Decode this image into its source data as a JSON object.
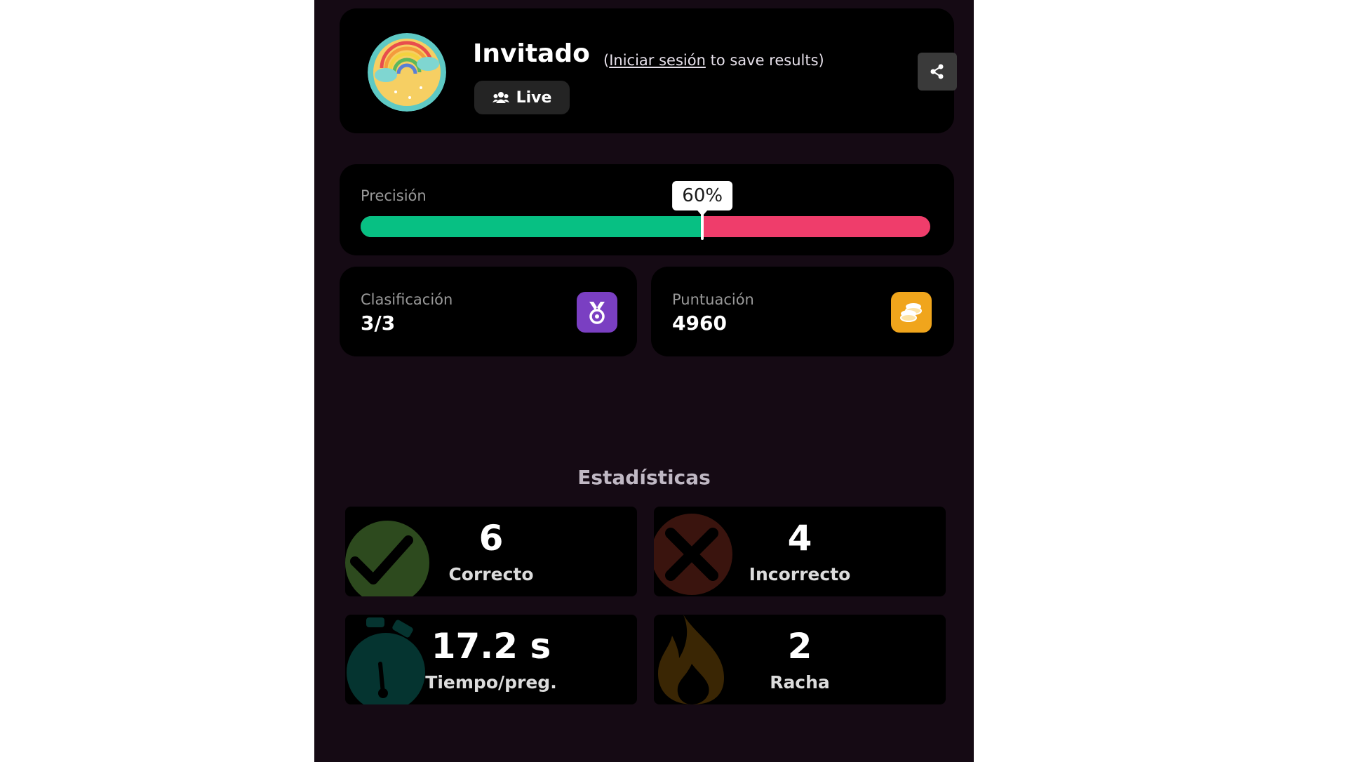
{
  "header": {
    "username": "Invitado",
    "login_prefix": "(",
    "login_link": "Iniciar sesión",
    "login_suffix": " to save results)",
    "mode_label": "Live"
  },
  "precision": {
    "label": "Precisión",
    "percent_text": "60%",
    "value": 0.6,
    "correct_color": "#07c083",
    "incorrect_color": "#ef3d6b"
  },
  "ranking": {
    "label": "Clasificación",
    "value": "3/3",
    "badge_color": "#7a3fc2"
  },
  "score": {
    "label": "Puntuación",
    "value": "4960",
    "badge_color": "#f0a51c"
  },
  "stats": {
    "title": "Estadísticas",
    "correct": {
      "value": "6",
      "label": "Correcto",
      "icon": "check-icon"
    },
    "incorrect": {
      "value": "4",
      "label": "Incorrecto",
      "icon": "cross-icon"
    },
    "time": {
      "value": "17.2 s",
      "label": "Tiempo/preg.",
      "icon": "stopwatch-icon"
    },
    "streak": {
      "value": "2",
      "label": "Racha",
      "icon": "flame-icon"
    }
  }
}
